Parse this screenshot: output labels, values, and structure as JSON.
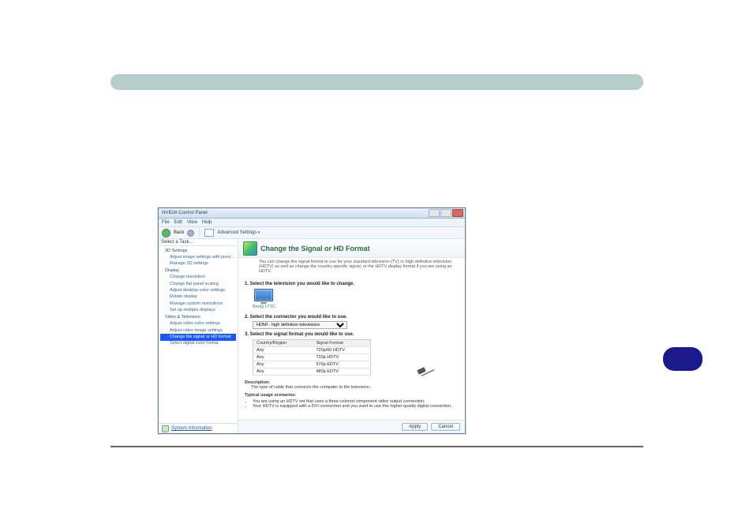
{
  "window": {
    "title": "NVIDIA Control Panel",
    "menus": {
      "file": "File",
      "edit": "Edit",
      "view": "View",
      "help": "Help"
    },
    "toolbar": {
      "back": "Back",
      "advanced": "Advanced Settings"
    },
    "sidebar_header": "Select a Task...",
    "status_link": "System Information"
  },
  "sidebar": {
    "items": [
      {
        "label": "3D Settings",
        "lvl": 1
      },
      {
        "label": "Adjust image settings with preview",
        "lvl": 2
      },
      {
        "label": "Manage 3D settings",
        "lvl": 2
      },
      {
        "label": "Display",
        "lvl": 1
      },
      {
        "label": "Change resolution",
        "lvl": 2
      },
      {
        "label": "Change flat panel scaling",
        "lvl": 2
      },
      {
        "label": "Adjust desktop color settings",
        "lvl": 2
      },
      {
        "label": "Rotate display",
        "lvl": 2
      },
      {
        "label": "Manage custom resolutions",
        "lvl": 2
      },
      {
        "label": "Set up multiple displays",
        "lvl": 2
      },
      {
        "label": "Video & Television",
        "lvl": 1
      },
      {
        "label": "Adjust video color settings",
        "lvl": 2
      },
      {
        "label": "Adjust video image settings",
        "lvl": 2
      },
      {
        "label": "Change the signal or HD format",
        "lvl": 2,
        "selected": true
      },
      {
        "label": "Select digital color format",
        "lvl": 2
      }
    ]
  },
  "content": {
    "heading": "Change the Signal or HD Format",
    "subheading": "You can change the signal format to use for your standard television (TV) or high definition television (HDTV) as well as change the country-specific signal, or the HDTV display format if you are using an HDTV.",
    "step1_label": "1. Select the television you would like to change.",
    "tv_caption": "BenQ LTTC",
    "step2_label": "2. Select the connector you would like to use.",
    "connector_selected": "HDMI - high definition televisions",
    "step3_label": "3. Select the signal format you would like to use.",
    "table": {
      "headers": {
        "col1": "Country/Region",
        "col2": "Signal Format"
      },
      "rows": [
        {
          "c1": "Any",
          "c2": "720p/60 HDTV"
        },
        {
          "c1": "Any",
          "c2": "720p HDTV"
        },
        {
          "c1": "Any",
          "c2": "576p EDTV"
        },
        {
          "c1": "Any",
          "c2": "480p EDTV"
        }
      ]
    },
    "description": {
      "title": "Description:",
      "text": "The type of cable that connects the computer to the television.",
      "usage_title": "Typical usage scenarios:",
      "bullets": [
        "You are using an HDTV set that uses a three-colored component video output connection.",
        "Your HDTV is equipped with a DVI connection and you want to use this higher quality digital connection."
      ]
    },
    "buttons": {
      "apply": "Apply",
      "cancel": "Cancel"
    }
  }
}
